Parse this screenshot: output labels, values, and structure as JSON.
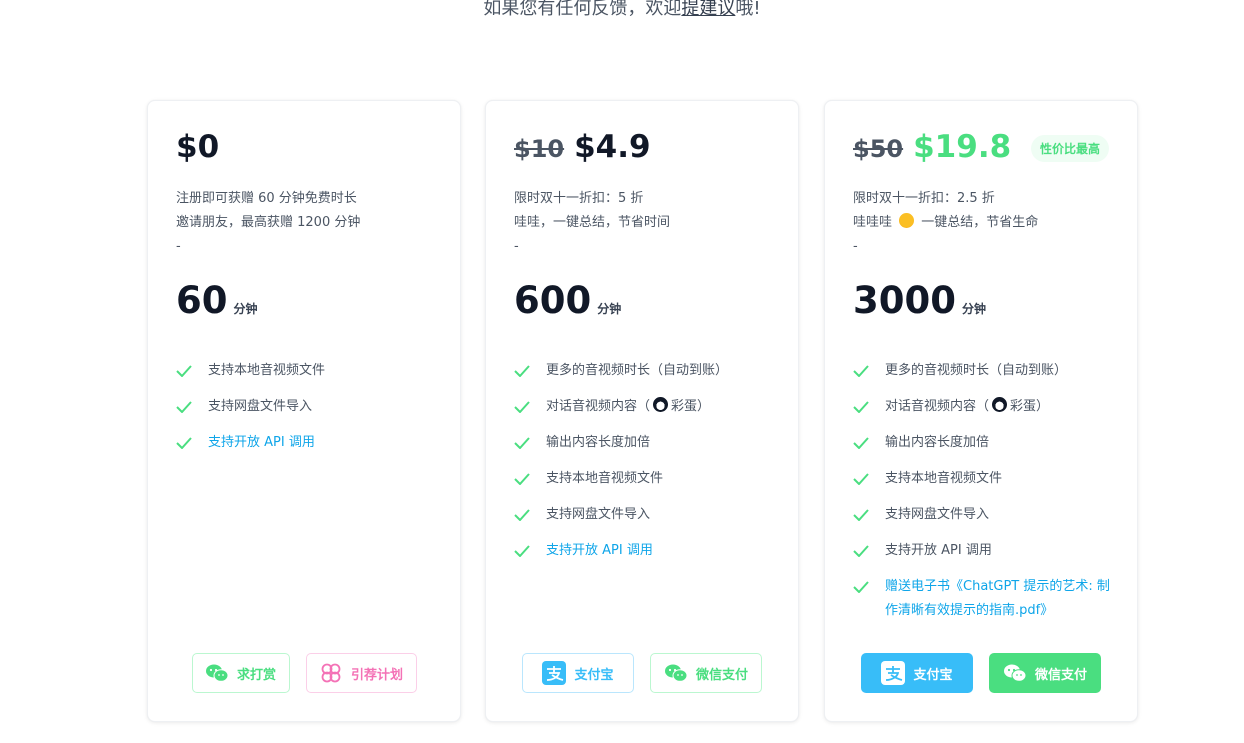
{
  "header": {
    "text_before": "如果您有任何反馈，欢迎",
    "link": "提建议",
    "text_after": "哦!"
  },
  "plans": [
    {
      "price": "$0",
      "desc": [
        "注册即可获赠 60 分钟免费时长",
        "邀请朋友，最高获赠 1200 分钟",
        "-"
      ],
      "minutes": "60",
      "unit": "分钟",
      "features": [
        "支持本地音视频文件",
        "支持网盘文件导入",
        "支持开放 API 调用"
      ],
      "buttons": [
        "求打赏",
        "引荐计划"
      ]
    },
    {
      "old_price": "$10",
      "price": "$4.9",
      "desc": [
        "限时双十一折扣：5 折",
        "哇哇，一键总结，节省时间",
        "-"
      ],
      "minutes": "600",
      "unit": "分钟",
      "features": [
        "更多的音视频时长（自动到账）",
        "对话音视频内容（",
        "彩蛋）",
        "输出内容长度加倍",
        "支持本地音视频文件",
        "支持网盘文件导入",
        "支持开放 API 调用"
      ],
      "buttons": [
        "支付宝",
        "微信支付"
      ]
    },
    {
      "old_price": "$50",
      "price": "$19.8",
      "badge": "性价比最高",
      "desc": [
        "限时双十一折扣：2.5 折",
        "哇哇哇",
        "一键总结，节省生命",
        "-"
      ],
      "minutes": "3000",
      "unit": "分钟",
      "features": [
        "更多的音视频时长（自动到账）",
        "对话音视频内容（",
        "彩蛋）",
        "输出内容长度加倍",
        "支持本地音视频文件",
        "支持网盘文件导入",
        "支持开放 API 调用",
        "赠送电子书《ChatGPT 提示的艺术: 制作清晰有效提示的指南.pdf》"
      ],
      "buttons": [
        "支付宝",
        "微信支付"
      ]
    }
  ],
  "colors": {
    "green": "#4ade80",
    "blue": "#38bdf8",
    "pink": "#f472b6",
    "link": "#0ea5e9"
  },
  "icons": [
    "check-icon",
    "wechat-icon",
    "clover-icon",
    "alipay-icon",
    "star-eyes-emoji",
    "penguin-emoji"
  ]
}
